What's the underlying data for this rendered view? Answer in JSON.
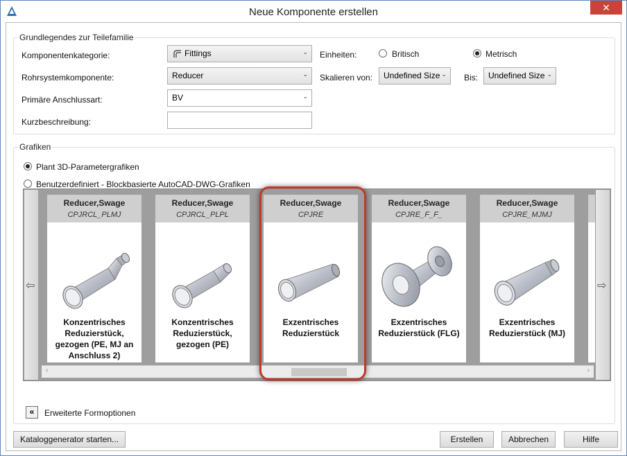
{
  "window": {
    "title": "Neue Komponente erstellen",
    "close_glyph": "✕"
  },
  "basics": {
    "legend": "Grundlegendes zur Teilefamilie",
    "category": {
      "label": "Komponentenkategorie:",
      "value": "Fittings",
      "icon": "fitting-icon"
    },
    "component": {
      "label": "Rohrsystemkomponente:",
      "value": "Reducer"
    },
    "connection": {
      "label": "Primäre Anschlussart:",
      "value": "BV"
    },
    "short_desc": {
      "label": "Kurzbeschreibung:",
      "value": ""
    },
    "units": {
      "label": "Einheiten:",
      "option1": "Britisch",
      "option2": "Metrisch",
      "selected": "Metrisch"
    },
    "scale_from": {
      "label": "Skalieren von:",
      "value": "Undefined Size"
    },
    "scale_to": {
      "label": "Bis:",
      "value": "Undefined Size"
    }
  },
  "graphics": {
    "legend": "Grafiken",
    "option1": "Plant 3D-Parametergrafiken",
    "option2": "Benutzerdefiniert - Blockbasierte AutoCAD-DWG-Grafiken",
    "selected": "Plant 3D-Parametergrafiken",
    "cards": [
      {
        "type": "Reducer,Swage",
        "code": "CPJRCL_PLMJ",
        "desc": "Konzentrisches Reduzierstück, gezogen (PE, MJ an Anschluss 2)"
      },
      {
        "type": "Reducer,Swage",
        "code": "CPJRCL_PLPL",
        "desc": "Konzentrisches Reduzierstück, gezogen (PE)"
      },
      {
        "type": "Reducer,Swage",
        "code": "CPJRE",
        "desc": "Exzentrisches Reduzierstück",
        "selected": true
      },
      {
        "type": "Reducer,Swage",
        "code": "CPJRE_F_F_",
        "desc": "Exzentrisches Reduzierstück (FLG)"
      },
      {
        "type": "Reducer,Swage",
        "code": "CPJRE_MJMJ",
        "desc": "Exzentrisches Reduzierstück (MJ)"
      }
    ]
  },
  "advanced": {
    "label": "Erweiterte Formoptionen"
  },
  "buttons": {
    "catalog": "Kataloggenerator starten...",
    "create": "Erstellen",
    "cancel": "Abbrechen",
    "help": "Hilfe"
  }
}
